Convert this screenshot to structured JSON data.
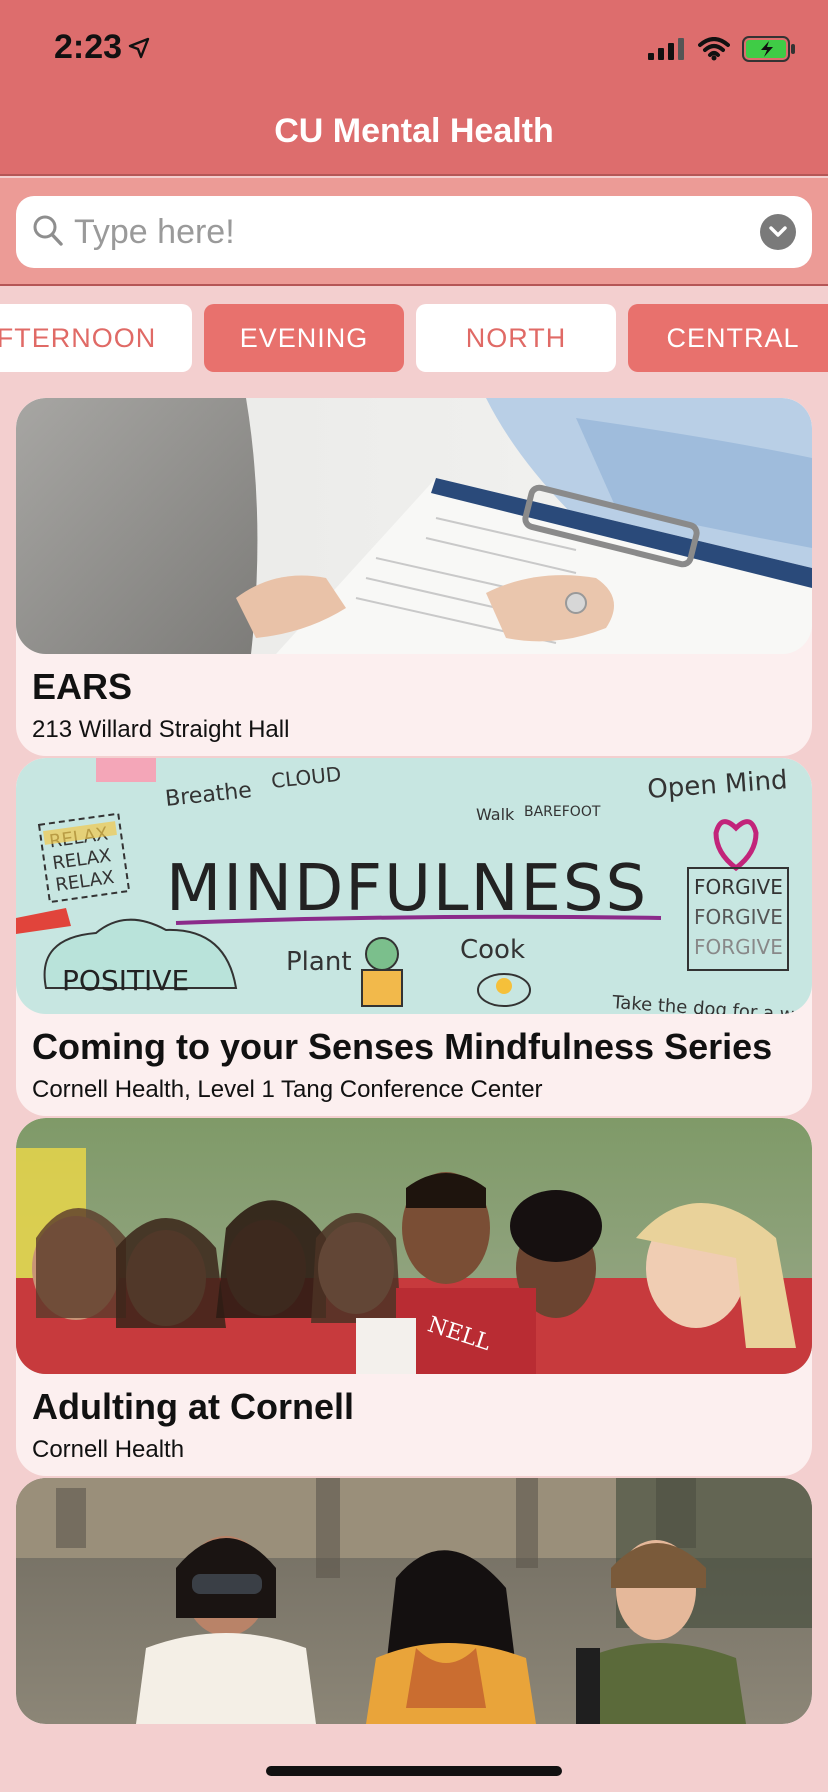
{
  "status": {
    "time": "2:23",
    "icons": [
      "location-arrow-icon",
      "signal-icon",
      "wifi-icon",
      "battery-charging-icon"
    ]
  },
  "app": {
    "title": "CU Mental Health"
  },
  "search": {
    "placeholder": "Type here!",
    "value": ""
  },
  "chips": [
    {
      "label": "AFTERNOON",
      "selected": false
    },
    {
      "label": "EVENING",
      "selected": true
    },
    {
      "label": "NORTH",
      "selected": false
    },
    {
      "label": "CENTRAL",
      "selected": true
    }
  ],
  "events": [
    {
      "title": "EARS",
      "location": "213 Willard Straight Hall",
      "image": "clipboard-form-photo"
    },
    {
      "title": "Coming to your Senses Mindfulness Series",
      "location": "Cornell Health, Level 1 Tang Conference Center",
      "image": "mindfulness-sketch-illustration",
      "image_text": [
        "MINDFULNESS",
        "Breathe",
        "CLOUD",
        "Walk",
        "BAREFOOT",
        "Open Mind",
        "RELAX",
        "FORGIVE",
        "Plant",
        "Cook",
        "POSITIVE",
        "Take the dog for a walk"
      ]
    },
    {
      "title": "Adulting at Cornell",
      "location": "Cornell Health",
      "image": "students-cheering-photo"
    },
    {
      "title": "",
      "location": "",
      "image": "students-walking-photo"
    }
  ],
  "colors": {
    "header": "#dd6d6d",
    "search_bar_bg": "#ec9b96",
    "page_bg": "#f3cfcf",
    "chip_selected": "#e8716d",
    "card_bg": "#fcefef"
  }
}
